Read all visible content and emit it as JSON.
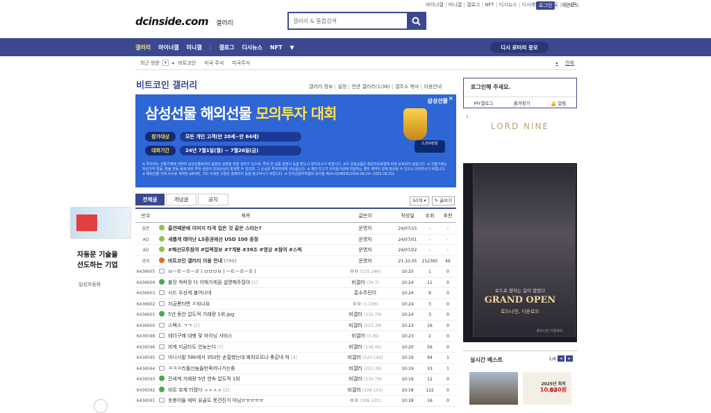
{
  "top_links": [
    "마이너갤",
    "미니갤",
    "갤로그",
    "NFT",
    "디시뉴스",
    "디시게임",
    "이벤트",
    "디시콘"
  ],
  "login_label": "로그인",
  "night_mode": "야간모드",
  "logo": "dcinside.com",
  "logo_sub": "갤러리",
  "search": {
    "placeholder": "갤러리 & 통합검색"
  },
  "nav": {
    "items": [
      "갤러리",
      "마이너갤",
      "미니갤",
      "갤로그",
      "디시뉴스",
      "NFT"
    ],
    "lotto": "디시 로터리 응모"
  },
  "recent": {
    "label": "최근 방문",
    "crumbs": [
      "비트코인",
      "미국 주식",
      "미국주식"
    ],
    "all": "전체"
  },
  "gallery": {
    "title": "비트코인 갤러리",
    "menu": [
      "갤러리 정보",
      "설정",
      "연관 갤러리(1/36)",
      "갤주소 복사",
      "이용안내"
    ]
  },
  "banner": {
    "brand": "삼성선물",
    "headline_a": "삼성선물 해외선물 ",
    "headline_b": "모의투자 대회",
    "pill1": "참가대상",
    "pill1_text": "모든 개인 고객(만 20세~만 64세)",
    "pill2": "대회기간",
    "pill2_text": "24년 7월1일(월) ~ 7월26일(금)",
    "prize": "2,250만원",
    "note": "※ 투자자는 선물거래에 대하여 삼성선물로부터 충분한 설명을 받을 권리가 있으며, 투자 전 상품 설명서 등을 반드시 읽어보시기 바랍니다. ※이 금융상품은 예금자보호법에 따라 보호되지 않습니다. ※ 선물거래는 자산가격 변동, 환율 변동 등에 따라 투자 원금의 초과손실이 발생할 수 있으며, 그 손실은 투자자에게 귀속됩니다. ※ 제반 친고가 유지증거금에 미달하는 경우 계약이 강제 청산될 수 있으니 유의하시기 바랍니다. ※ 해외선물 거래 수수료 계약당 $8이며, 기타 자세한 사항은 홈페이지 등을 참고하시기 바랍니다. ※ 한국금융투자협회 심사필 제24-02485호(2024.06.24~2025.06.23)"
  },
  "tabs": [
    "전체글",
    "개념글",
    "공지"
  ],
  "list_options": [
    "50개",
    "글쓰기"
  ],
  "columns": [
    "번호",
    "제목",
    "글쓴이",
    "작성일",
    "조회",
    "추천"
  ],
  "rows": [
    {
      "num": "설문",
      "icon": "y",
      "title": "흡연때문에 이미지 타격 입은 것 같은 스타는?",
      "comments": "",
      "writer": "운영자",
      "date": "24/07/15",
      "views": "-",
      "rec": "-",
      "bold": true
    },
    {
      "num": "AD",
      "icon": "y",
      "title": "새롭게 태어난 LS증권에선 USD 100 증정",
      "comments": "",
      "writer": "운영자",
      "date": "24/07/01",
      "views": "-",
      "rec": "-",
      "bold": true
    },
    {
      "num": "AD",
      "icon": "y",
      "title": "#해선모투참여 #입력정보 #7개봉 #39조 #영상 #참여 #스벅",
      "comments": "",
      "writer": "운영자",
      "date": "24/07/02",
      "views": "-",
      "rec": "-",
      "bold": true
    },
    {
      "num": "공지",
      "icon": "o",
      "title": "비트코인 갤러리 이용 안내",
      "comments": "[790]",
      "writer": "운영자",
      "date": "21.10.05",
      "views": "212365",
      "rec": "46",
      "bold": true
    },
    {
      "num": "6436605",
      "icon": "t",
      "title": "ㅂㅡㅌㅡㄹㅡㄹㅣㅁㅁㅁㅂㅣㅡㅌㅡㄹㅡㄹㅣ",
      "comments": "",
      "writer": "ㅇㅇ",
      "wsub": "(125.246)",
      "date": "10:25",
      "views": "1",
      "rec": "0",
      "bold": false
    },
    {
      "num": "6436604",
      "icon": "g",
      "title": "불장 하락장 다 이해가게끔 설명해주잖아",
      "comments": "[1]",
      "writer": "비갤러",
      "wsub": "(39.7)",
      "date": "10:24",
      "views": "11",
      "rec": "0",
      "bold": false
    },
    {
      "num": "6436603",
      "icon": "t",
      "title": "시드 우선게 불어나네",
      "comments": "",
      "writer": "흥소주린이",
      "wsub": "",
      "date": "10:24",
      "views": "9",
      "rec": "0",
      "bold": false
    },
    {
      "num": "6436602",
      "icon": "t",
      "title": "지금롱타면 ㅈ되나요",
      "comments": "",
      "writer": "ㅇㅇ",
      "wsub": "(1.236)",
      "date": "10:24",
      "views": "3",
      "rec": "0",
      "bold": false
    },
    {
      "num": "6436601",
      "icon": "g",
      "title": "5년 동안 압도적 거래량 1위.jpg",
      "comments": "",
      "writer": "비갤러",
      "wsub": "(110.79)",
      "date": "10:24",
      "views": "3",
      "rec": "0",
      "bold": false
    },
    {
      "num": "6436600",
      "icon": "t",
      "title": "스택스 ㄱㄱ",
      "comments": "[2]",
      "writer": "비갤러",
      "wsub": "(223.39)",
      "date": "10:23",
      "views": "16",
      "rec": "0",
      "bold": false
    },
    {
      "num": "6436598",
      "icon": "t",
      "title": "테더구매 대행 및 마이닝 서비스",
      "comments": "",
      "writer": "비갤러",
      "wsub": "(3.36)",
      "date": "10:23",
      "views": "2",
      "rec": "0",
      "bold": false
    },
    {
      "num": "6436596",
      "icon": "t",
      "title": "비캐 지금타도 안늦는다",
      "comments": "[7]",
      "writer": "비갤러",
      "wsub": "(116.45)",
      "date": "10:20",
      "views": "56",
      "rec": "0",
      "bold": false
    },
    {
      "num": "6436595",
      "icon": "t",
      "title": "아니시발 58k에서 350만 손절했는데 왜처오르냐 좆같네 하",
      "comments": "[4]",
      "writer": "비갤러",
      "wsub": "(120.142)",
      "date": "10:19",
      "views": "94",
      "rec": "1",
      "bold": false
    },
    {
      "num": "6436594",
      "icon": "t",
      "title": "ㅋㅋㅋ리플산놈들만죽어나가는중",
      "comments": "",
      "writer": "비갤러",
      "wsub": "(223.39)",
      "date": "10:19",
      "views": "33",
      "rec": "1",
      "bold": false
    },
    {
      "num": "6436593",
      "icon": "g",
      "title": "전세계 거래량 5년 연속 압도적 1위",
      "comments": "",
      "writer": "비갤러",
      "wsub": "(110.79)",
      "date": "10:19",
      "views": "12",
      "rec": "0",
      "bold": false
    },
    {
      "num": "6436592",
      "icon": "g",
      "title": "비트 호재 터졌다 ㅅㅅㅅㅅ",
      "comments": "[2]",
      "writer": "비갤러",
      "wsub": "(106.101)",
      "date": "10:18",
      "views": "122",
      "rec": "0",
      "bold": false
    },
    {
      "num": "6436591",
      "icon": "t",
      "title": "숏충이들 애미 유골도 못건진거 아님ㅠㅠㅠㅠㅠ",
      "comments": "",
      "writer": "ㅇㅇ",
      "wsub": "(106.101)",
      "date": "10:18",
      "views": "16",
      "rec": "0",
      "bold": false
    }
  ],
  "login_box": {
    "title": "로그인해 주세요.",
    "links": [
      "MY갤로그",
      "즐겨찾기",
      "알림"
    ]
  },
  "side_ad": {
    "brand": "LORD NINE",
    "sub": "로드로 향하는 길이 열렸다",
    "grand": "GRAND OPEN",
    "sub2": "로드나인, 다운로드",
    "foot": "로드나인 다운로드"
  },
  "best": {
    "title": "실시간 베스트",
    "page": "1/8",
    "poster_line1": "2025년 최저임금",
    "poster_line2": "10,030원"
  },
  "left_ad": {
    "headline_1": "자동문 기술을",
    "headline_2": "선도하는 기업",
    "company": "일성자동화"
  },
  "colors": {
    "accent": "#3b4890",
    "highlight": "#f5e070"
  }
}
